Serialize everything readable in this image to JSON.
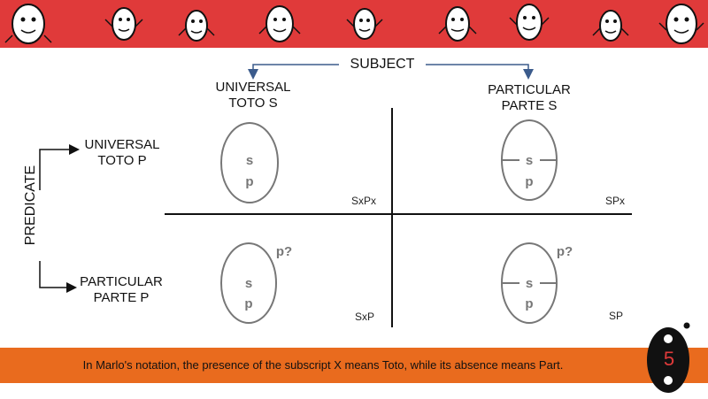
{
  "header": {
    "decoration": "cartoon-egg-characters",
    "color": "#e03a3a"
  },
  "subject": {
    "label": "SUBJECT"
  },
  "predicate": {
    "label": "PREDICATE"
  },
  "columns": {
    "universal": {
      "line1": "UNIVERSAL",
      "line2": "TOTO S"
    },
    "particular": {
      "line1": "PARTICULAR",
      "line2": "PARTE S"
    }
  },
  "rows": {
    "universal": {
      "line1": "UNIVERSAL",
      "line2": "TOTO P"
    },
    "particular": {
      "line1": "PARTICULAR",
      "line2": "PARTE P"
    }
  },
  "quadrants": {
    "top_left": {
      "s": "s",
      "p": "p",
      "code": "SxPx"
    },
    "top_right": {
      "s": "s",
      "p": "p",
      "code": "SPx"
    },
    "bottom_left": {
      "s": "s",
      "p": "p",
      "q": "p?",
      "code": "SxP"
    },
    "bottom_right": {
      "s": "s",
      "p": "p",
      "q": "p?",
      "code": "SP"
    }
  },
  "footer": {
    "text": "In Marlo's notation, the presence of the subscript X means Toto, while its absence means Part.",
    "color": "#e96b1e"
  },
  "page_badge": {
    "number": "5"
  }
}
